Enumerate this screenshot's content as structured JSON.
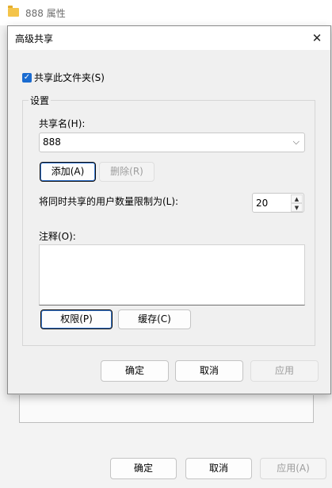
{
  "outer": {
    "title": "888 属性",
    "ok_label": "确定",
    "cancel_label": "取消",
    "apply_label": "应用(A)"
  },
  "dialog": {
    "title": "高级共享",
    "close_glyph": "✕",
    "share_checkbox": {
      "label": "共享此文件夹(S)",
      "checked": true,
      "glyph": "✓"
    },
    "group_label": "设置",
    "share_name_label": "共享名(H):",
    "share_name_value": "888",
    "add_label": "添加(A)",
    "remove_label": "删除(R)",
    "limit_label": "将同时共享的用户数量限制为(L):",
    "limit_value": "20",
    "comment_label": "注释(O):",
    "comment_value": "",
    "permissions_label": "权限(P)",
    "caching_label": "缓存(C)",
    "ok_label": "确定",
    "cancel_label": "取消",
    "apply_label": "应用"
  },
  "icons": {
    "folder": "folder-icon",
    "close": "close-icon",
    "combo_arrow": "chevron-down-icon",
    "spin_up": "spin-up-icon",
    "spin_down": "spin-down-icon"
  },
  "colors": {
    "accent": "#1a6bd0",
    "folder": "#f4c44a",
    "disabled_text": "#9d9d9d"
  }
}
